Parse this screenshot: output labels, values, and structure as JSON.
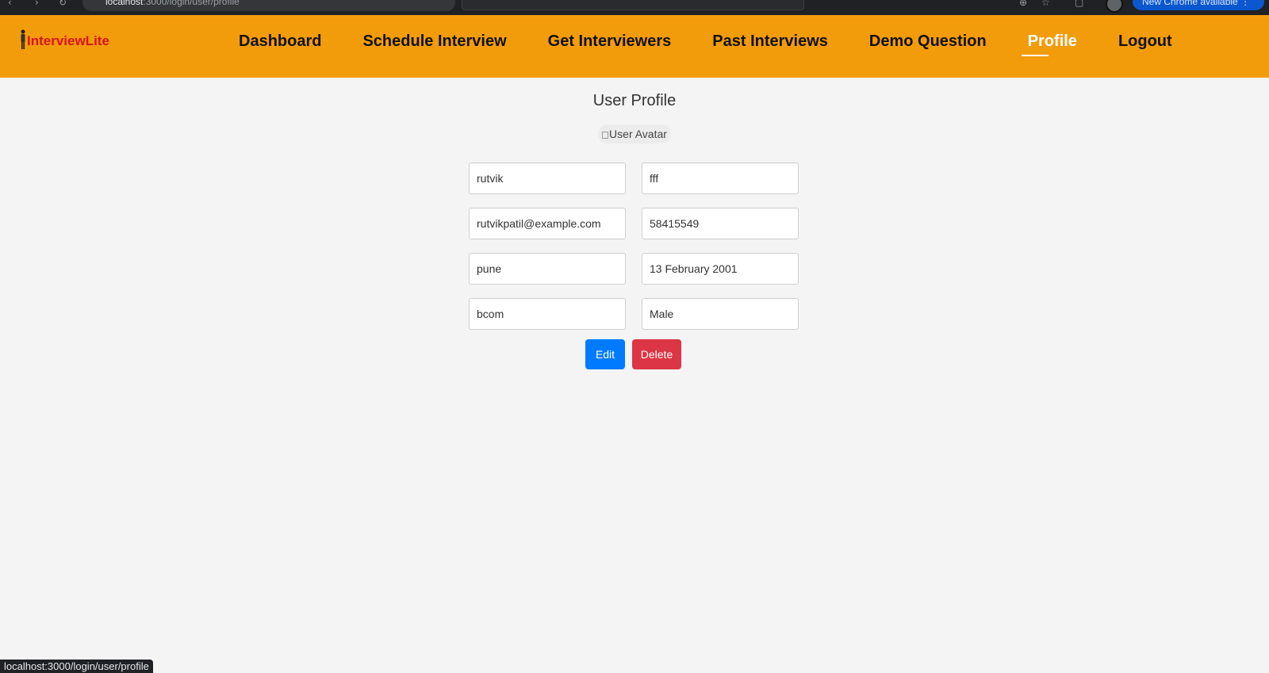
{
  "browser": {
    "url_host": "localhost",
    "url_path": ":3000/login/user/profile",
    "update_label": "New Chrome available"
  },
  "navbar": {
    "brand": "InterviewLite",
    "links": [
      {
        "label": "Dashboard",
        "active": false
      },
      {
        "label": "Schedule Interview",
        "active": false
      },
      {
        "label": "Get Interviewers",
        "active": false
      },
      {
        "label": "Past Interviews",
        "active": false
      },
      {
        "label": "Demo Question",
        "active": false
      },
      {
        "label": "Profile",
        "active": true
      },
      {
        "label": "Logout",
        "active": false
      }
    ]
  },
  "profile": {
    "title": "User Profile",
    "avatar_alt": "User Avatar",
    "fields": {
      "first_name": "rutvik",
      "last_name": "fff",
      "email": "rutvikpatil@example.com",
      "phone": "58415549",
      "city": "pune",
      "dob": "13 February 2001",
      "education": "bcom",
      "gender": "Male"
    },
    "edit_label": "Edit",
    "delete_label": "Delete"
  },
  "status_bar": {
    "link": "localhost:3000/login/user/profile"
  },
  "colors": {
    "navbar": "#f39c0b",
    "brand": "#d8141a",
    "edit": "#007bff",
    "delete": "#dc3545"
  }
}
